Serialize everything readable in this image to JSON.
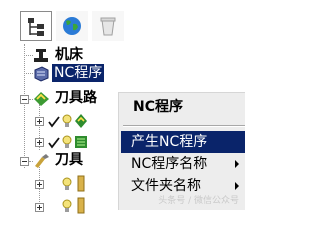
{
  "toolbar": {
    "buttons": [
      {
        "icon": "tree-view-icon",
        "active": true
      },
      {
        "icon": "globe-icon",
        "active": false
      },
      {
        "icon": "recycle-bin-icon",
        "active": false
      }
    ]
  },
  "tree": {
    "nodes": {
      "machine": {
        "label": "机床",
        "icon": "machine-icon"
      },
      "nc_program": {
        "label": "NC程序",
        "icon": "nc-program-icon",
        "selected": true
      },
      "toolpath": {
        "label": "刀具路",
        "icon": "toolpath-icon"
      },
      "tool": {
        "label": "刀具",
        "icon": "tool-icon"
      }
    }
  },
  "context_menu": {
    "title": "NC程序",
    "items": [
      {
        "label": "产生NC程序",
        "highlighted": true,
        "submenu": false
      },
      {
        "label": "NC程序名称",
        "highlighted": false,
        "submenu": true
      },
      {
        "label": "文件夹名称",
        "highlighted": false,
        "submenu": true
      }
    ]
  },
  "watermark": "头条号 / 微信公众号",
  "colors": {
    "selection": "#0a246a",
    "menu_bg": "#ededed"
  }
}
